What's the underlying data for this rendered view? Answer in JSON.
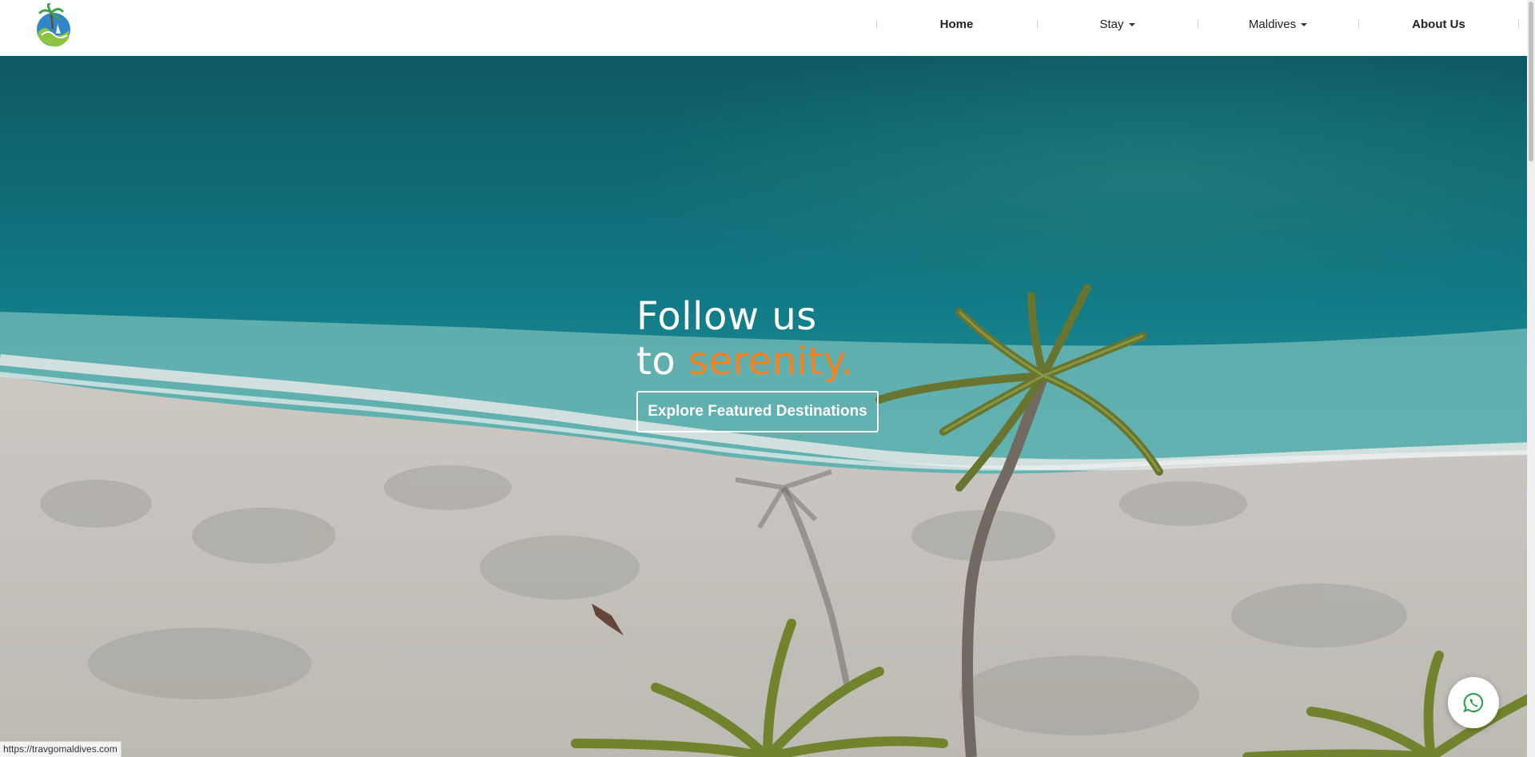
{
  "header": {
    "logo_icon": "travgo-palm-wave-logo-icon",
    "nav": [
      {
        "label": "Home",
        "bold": true,
        "dropdown": false
      },
      {
        "label": "Stay",
        "bold": false,
        "dropdown": true
      },
      {
        "label": "Maldives",
        "bold": false,
        "dropdown": true
      },
      {
        "label": "About Us",
        "bold": true,
        "dropdown": false
      }
    ]
  },
  "hero": {
    "line1": "Follow us",
    "line2_prefix": "to",
    "line2_accent": "serenity.",
    "cta_label": "Explore Featured Destinations",
    "accent_color": "#f5821f",
    "background": "aerial-beach-palm-photo"
  },
  "floating": {
    "whatsapp_icon": "whatsapp-icon"
  },
  "status_bar": {
    "url": "https://travgomaldives.com"
  }
}
